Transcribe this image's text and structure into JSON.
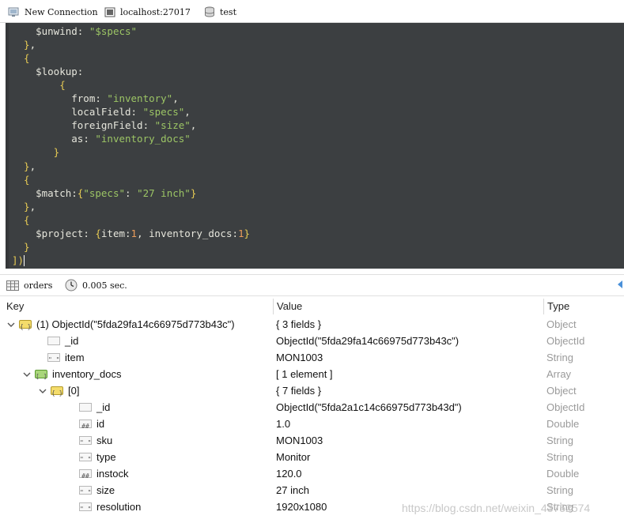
{
  "connection": {
    "name": "New Connection",
    "host": "localhost:27017",
    "database": "test"
  },
  "editor": {
    "lines": [
      [
        {
          "t": "kw",
          "v": "    $unwind"
        },
        {
          "t": "txt",
          "v": ": "
        },
        {
          "t": "str",
          "v": "\"$specs\""
        }
      ],
      [
        {
          "t": "br",
          "v": "  }"
        },
        {
          "t": "txt",
          "v": ","
        }
      ],
      [
        {
          "t": "br",
          "v": "  {"
        }
      ],
      [
        {
          "t": "kw",
          "v": "    $lookup"
        },
        {
          "t": "txt",
          "v": ":"
        }
      ],
      [
        {
          "t": "br",
          "v": "        {"
        }
      ],
      [
        {
          "t": "kw",
          "v": "          from"
        },
        {
          "t": "txt",
          "v": ": "
        },
        {
          "t": "str",
          "v": "\"inventory\""
        },
        {
          "t": "txt",
          "v": ","
        }
      ],
      [
        {
          "t": "kw",
          "v": "          localField"
        },
        {
          "t": "txt",
          "v": ": "
        },
        {
          "t": "str",
          "v": "\"specs\""
        },
        {
          "t": "txt",
          "v": ","
        }
      ],
      [
        {
          "t": "kw",
          "v": "          foreignField"
        },
        {
          "t": "txt",
          "v": ": "
        },
        {
          "t": "str",
          "v": "\"size\""
        },
        {
          "t": "txt",
          "v": ","
        }
      ],
      [
        {
          "t": "kw",
          "v": "          as"
        },
        {
          "t": "txt",
          "v": ": "
        },
        {
          "t": "str",
          "v": "\"inventory_docs\""
        }
      ],
      [
        {
          "t": "br",
          "v": "       }"
        }
      ],
      [
        {
          "t": "br",
          "v": "  }"
        },
        {
          "t": "txt",
          "v": ","
        }
      ],
      [
        {
          "t": "br",
          "v": "  {"
        }
      ],
      [
        {
          "t": "kw",
          "v": "    $match"
        },
        {
          "t": "txt",
          "v": ":"
        },
        {
          "t": "br",
          "v": "{"
        },
        {
          "t": "str",
          "v": "\"specs\""
        },
        {
          "t": "txt",
          "v": ": "
        },
        {
          "t": "str",
          "v": "\"27 inch\""
        },
        {
          "t": "br",
          "v": "}"
        }
      ],
      [
        {
          "t": "br",
          "v": "  }"
        },
        {
          "t": "txt",
          "v": ","
        }
      ],
      [
        {
          "t": "br",
          "v": "  {"
        }
      ],
      [
        {
          "t": "kw",
          "v": "    $project"
        },
        {
          "t": "txt",
          "v": ": "
        },
        {
          "t": "br",
          "v": "{"
        },
        {
          "t": "txt",
          "v": "item:"
        },
        {
          "t": "num",
          "v": "1"
        },
        {
          "t": "txt",
          "v": ", inventory_docs:"
        },
        {
          "t": "num",
          "v": "1"
        },
        {
          "t": "br",
          "v": "}"
        }
      ],
      [
        {
          "t": "br",
          "v": "  }"
        }
      ],
      [
        {
          "t": "br",
          "v": "])"
        }
      ]
    ]
  },
  "status": {
    "collection": "orders",
    "time": "0.005 sec."
  },
  "table": {
    "headers": {
      "key": "Key",
      "value": "Value",
      "type": "Type"
    },
    "rows": [
      {
        "indent": 0,
        "toggle": "open",
        "icon": "object-icon",
        "key": "(1) ObjectId(\"5fda29fa14c66975d773b43c\")",
        "value": "{ 3 fields }",
        "type": "Object"
      },
      {
        "indent": 1,
        "toggle": "none",
        "icon": "objectid-icon",
        "key": "_id",
        "value": "ObjectId(\"5fda29fa14c66975d773b43c\")",
        "type": "ObjectId"
      },
      {
        "indent": 1,
        "toggle": "none",
        "icon": "string-icon",
        "key": "item",
        "value": "MON1003",
        "type": "String"
      },
      {
        "indent": 1,
        "toggle": "open",
        "icon": "array-icon",
        "key": "inventory_docs",
        "value": "[ 1 element ]",
        "type": "Array"
      },
      {
        "indent": 2,
        "toggle": "open",
        "icon": "object-icon",
        "key": "[0]",
        "value": "{ 7 fields }",
        "type": "Object"
      },
      {
        "indent": 3,
        "toggle": "none",
        "icon": "objectid-icon",
        "key": "_id",
        "value": "ObjectId(\"5fda2a1c14c66975d773b43d\")",
        "type": "ObjectId"
      },
      {
        "indent": 3,
        "toggle": "none",
        "icon": "number-icon",
        "key": "id",
        "value": "1.0",
        "type": "Double"
      },
      {
        "indent": 3,
        "toggle": "none",
        "icon": "string-icon",
        "key": "sku",
        "value": "MON1003",
        "type": "String"
      },
      {
        "indent": 3,
        "toggle": "none",
        "icon": "string-icon",
        "key": "type",
        "value": "Monitor",
        "type": "String"
      },
      {
        "indent": 3,
        "toggle": "none",
        "icon": "number-icon",
        "key": "instock",
        "value": "120.0",
        "type": "Double"
      },
      {
        "indent": 3,
        "toggle": "none",
        "icon": "string-icon",
        "key": "size",
        "value": "27 inch",
        "type": "String"
      },
      {
        "indent": 3,
        "toggle": "none",
        "icon": "string-icon",
        "key": "resolution",
        "value": "1920x1080",
        "type": "String"
      }
    ]
  },
  "watermark": "https://blog.csdn.net/weixin_43752574",
  "colors": {
    "editor_bg": "#3c3f41",
    "string": "#9cc565",
    "number": "#ea9c5a",
    "bracket": "#e7cb54"
  }
}
